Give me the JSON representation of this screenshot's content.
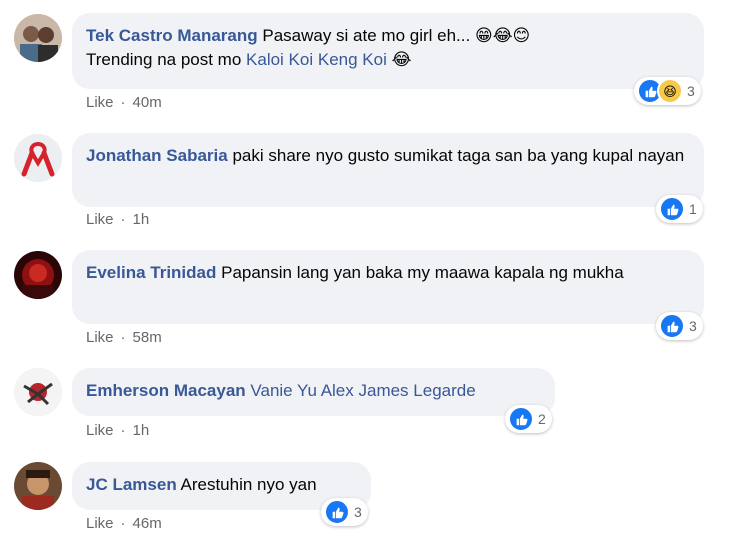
{
  "comments": [
    {
      "author": "Tek Castro Manarang",
      "text_line1": "Pasaway si ate mo girl eh...",
      "emojis_line1": "😁😂😊",
      "text_line2": "Trending na post mo",
      "tag": "Kaloi Koi Keng Koi",
      "emojis_line2": "😂",
      "like_label": "Like",
      "time": "40m",
      "reaction_count": "3",
      "reaction_icons": [
        "like-icon",
        "haha-icon"
      ]
    },
    {
      "author": "Jonathan Sabaria",
      "text": "paki share nyo gusto sumikat taga san ba yang kupal nayan",
      "like_label": "Like",
      "time": "1h",
      "reaction_count": "1",
      "reaction_icons": [
        "like-icon"
      ]
    },
    {
      "author": "Evelina Trinidad",
      "text": "Papansin lang yan baka my maawa kapala ng mukha",
      "like_label": "Like",
      "time": "58m",
      "reaction_count": "3",
      "reaction_icons": [
        "like-icon"
      ]
    },
    {
      "author": "Emherson Macayan",
      "tag": "Vanie Yu Alex James Legarde",
      "like_label": "Like",
      "time": "1h",
      "reaction_count": "2",
      "reaction_icons": [
        "like-icon"
      ]
    },
    {
      "author": "JC Lamsen",
      "text": "Arestuhin nyo yan",
      "like_label": "Like",
      "time": "46m",
      "reaction_count": "3",
      "reaction_icons": [
        "like-icon"
      ]
    }
  ],
  "colors": {
    "author_link": "#385898",
    "bubble_bg": "#f0f2f5",
    "meta_text": "#65676b",
    "like_blue": "#1877f2"
  }
}
